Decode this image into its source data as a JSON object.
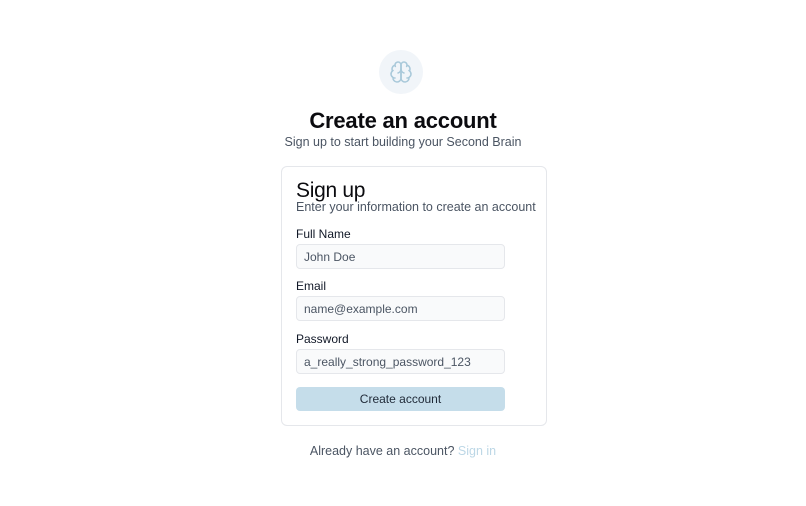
{
  "app": {
    "logo_icon": "brain-icon",
    "title": "Create an account",
    "subtitle": "Sign up to start building your Second Brain"
  },
  "form": {
    "heading": "Sign up",
    "description": "Enter your information to create an account",
    "fields": [
      {
        "label": "Full Name",
        "placeholder": "John Doe",
        "value": ""
      },
      {
        "label": "Email",
        "placeholder": "name@example.com",
        "value": ""
      },
      {
        "label": "Password",
        "placeholder": "",
        "value": "a_really_strong_password_123"
      }
    ],
    "submit_label": "Create account"
  },
  "footer": {
    "prompt": "Already have an account?",
    "link_label": "Sign in"
  },
  "colors": {
    "accent": "#c5ddea",
    "link": "#bcd7e6",
    "icon": "#a9c9da"
  }
}
